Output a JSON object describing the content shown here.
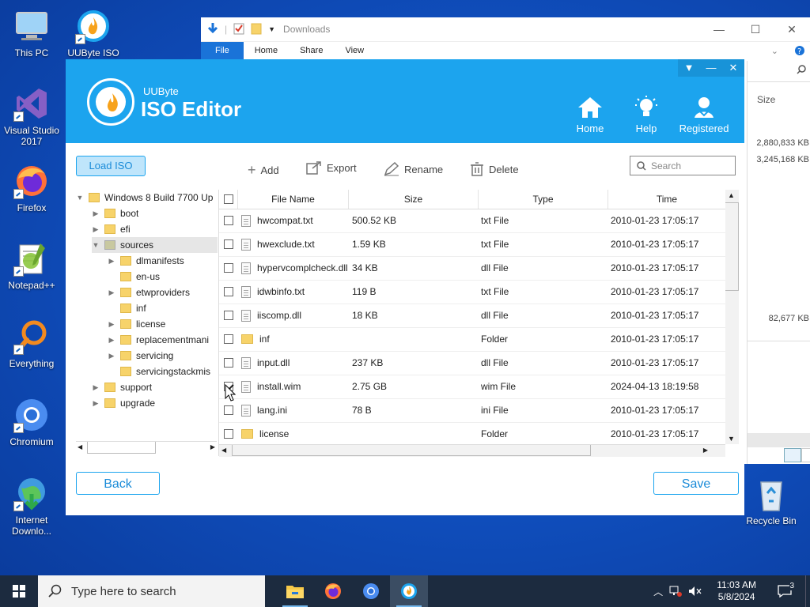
{
  "desktop": {
    "icons": [
      {
        "label": "This PC"
      },
      {
        "label": "UUByte ISO"
      },
      {
        "label": "Visual Studio 2017"
      },
      {
        "label": "Firefox"
      },
      {
        "label": "Notepad++"
      },
      {
        "label": "Everything"
      },
      {
        "label": "Chromium"
      },
      {
        "label": "Internet Downlo..."
      },
      {
        "label": "Recycle Bin"
      }
    ]
  },
  "explorer": {
    "title": "Downloads",
    "ribbon": [
      "File",
      "Home",
      "Share",
      "View"
    ],
    "size_header": "Size",
    "sizes": [
      "2,880,833 KB",
      "3,245,168 KB",
      "82,677 KB"
    ]
  },
  "app": {
    "brand_small": "UUByte",
    "brand_big": "ISO Editor",
    "nav": {
      "home": "Home",
      "help": "Help",
      "registered": "Registered"
    },
    "load_iso": "Load ISO",
    "toolbar": {
      "add": "Add",
      "export": "Export",
      "rename": "Rename",
      "delete": "Delete"
    },
    "search_placeholder": "Search",
    "tree": {
      "root": "Windows 8 Build 7700 Up",
      "items": [
        "boot",
        "efi",
        "sources",
        "dlmanifests",
        "en-us",
        "etwproviders",
        "inf",
        "license",
        "replacementmani",
        "servicing",
        "servicingstackmis",
        "support",
        "upgrade"
      ]
    },
    "columns": {
      "name": "File Name",
      "size": "Size",
      "type": "Type",
      "time": "Time"
    },
    "files": [
      {
        "name": "hwcompat.txt",
        "size": "500.52 KB",
        "type": "txt File",
        "time": "2010-01-23 17:05:17"
      },
      {
        "name": "hwexclude.txt",
        "size": "1.59 KB",
        "type": "txt File",
        "time": "2010-01-23 17:05:17"
      },
      {
        "name": "hypervcomplcheck.dll",
        "size": "34 KB",
        "type": "dll File",
        "time": "2010-01-23 17:05:17"
      },
      {
        "name": "idwbinfo.txt",
        "size": "119 B",
        "type": "txt File",
        "time": "2010-01-23 17:05:17"
      },
      {
        "name": "iiscomp.dll",
        "size": "18 KB",
        "type": "dll File",
        "time": "2010-01-23 17:05:17"
      },
      {
        "name": "inf",
        "size": "",
        "type": "Folder",
        "time": "2010-01-23 17:05:17"
      },
      {
        "name": "input.dll",
        "size": "237 KB",
        "type": "dll File",
        "time": "2010-01-23 17:05:17"
      },
      {
        "name": "install.wim",
        "size": "2.75 GB",
        "type": "wim File",
        "time": "2024-04-13 18:19:58"
      },
      {
        "name": "lang.ini",
        "size": "78 B",
        "type": "ini File",
        "time": "2010-01-23 17:05:17"
      },
      {
        "name": "license",
        "size": "",
        "type": "Folder",
        "time": "2010-01-23 17:05:17"
      }
    ],
    "back": "Back",
    "save": "Save"
  },
  "taskbar": {
    "search_placeholder": "Type here to search",
    "time": "11:03 AM",
    "date": "5/8/2024",
    "notifications": "3"
  },
  "colors": {
    "accent": "#1ca4ee",
    "taskbar": "#1c2b3f"
  }
}
